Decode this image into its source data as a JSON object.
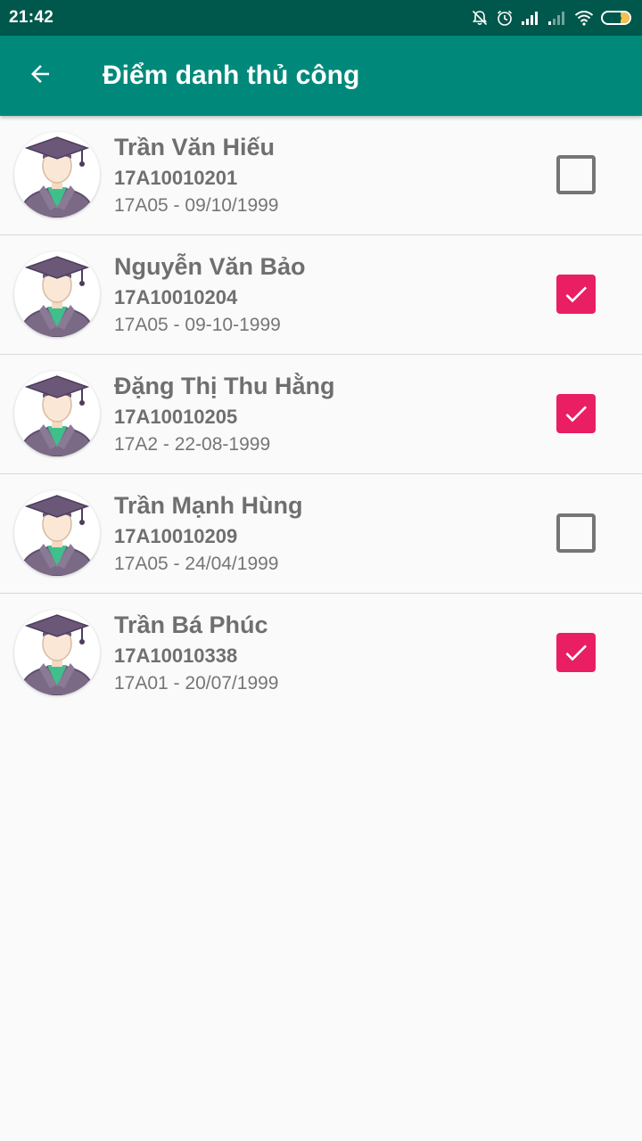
{
  "status_bar": {
    "time": "21:42",
    "battery_level": "35",
    "icons": [
      "notifications-off-icon",
      "alarm-icon",
      "signal-icon",
      "signal-weak-icon",
      "wifi-icon",
      "battery-icon"
    ]
  },
  "toolbar": {
    "back_icon": "arrow-back-icon",
    "title": "Điểm danh thủ công"
  },
  "colors": {
    "status_bar": "#00574b",
    "toolbar": "#00897b",
    "checkbox_checked": "#e91e63",
    "checkbox_unchecked": "#757575",
    "text": "#6f6f6f"
  },
  "students": [
    {
      "name": "Trần Văn Hiếu",
      "code": "17A10010201",
      "meta": "17A05 - 09/10/1999",
      "checked": false
    },
    {
      "name": "Nguyễn Văn Bảo",
      "code": "17A10010204",
      "meta": "17A05 - 09-10-1999",
      "checked": true
    },
    {
      "name": "Đặng Thị Thu Hằng",
      "code": "17A10010205",
      "meta": "17A2 - 22-08-1999",
      "checked": true
    },
    {
      "name": "Trần Mạnh Hùng",
      "code": "17A10010209",
      "meta": "17A05 - 24/04/1999",
      "checked": false
    },
    {
      "name": "Trần Bá Phúc",
      "code": "17A10010338",
      "meta": "17A01 - 20/07/1999",
      "checked": true
    }
  ]
}
